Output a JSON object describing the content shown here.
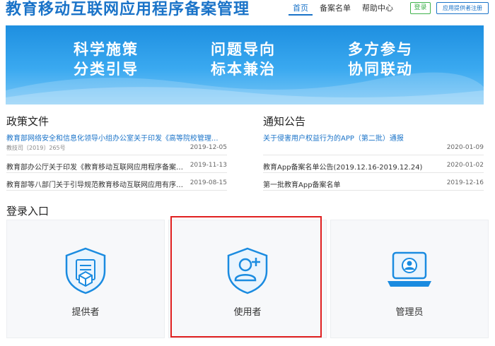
{
  "header": {
    "site_title": "教育移动互联网应用程序备案管理",
    "nav": [
      "首页",
      "备案名单",
      "帮助中心"
    ],
    "login_label": "登录",
    "register_label": "应用提供者注册"
  },
  "banner": {
    "slogans": [
      [
        "科学施策",
        "分类引导"
      ],
      [
        "问题导向",
        "标本兼治"
      ],
      [
        "多方参与",
        "协同联动"
      ]
    ]
  },
  "policy": {
    "title": "政策文件",
    "items": [
      {
        "title": "教育部网络安全和信息化领导小组办公室关于印发《高等院校管理...",
        "sub": "教技司〔2019〕265号",
        "date": "2019-12-05"
      },
      {
        "title": "教育部办公厅关于印发《教育移动互联网应用程序备案管理办法...",
        "date": "2019-11-13"
      },
      {
        "title": "教育部等八部门关于引导规范教育移动互联网应用有序健康发展...",
        "date": "2019-08-15"
      }
    ]
  },
  "notice": {
    "title": "通知公告",
    "items": [
      {
        "title": "关于侵害用户权益行为的APP（第二批）通报",
        "date": "2020-01-09"
      },
      {
        "title": "教育App备案名单公告(2019.12.16-2019.12.24)",
        "date": "2020-01-02"
      },
      {
        "title": "第一批教育App备案名单",
        "date": "2019-12-16"
      }
    ]
  },
  "login": {
    "title": "登录入口",
    "cards": [
      {
        "label": "提供者",
        "icon": "provider-icon"
      },
      {
        "label": "使用者",
        "icon": "user-icon"
      },
      {
        "label": "管理员",
        "icon": "admin-icon"
      }
    ]
  },
  "colors": {
    "brand": "#1a73c8",
    "green": "#3fb24c",
    "highlight": "#e02020"
  }
}
